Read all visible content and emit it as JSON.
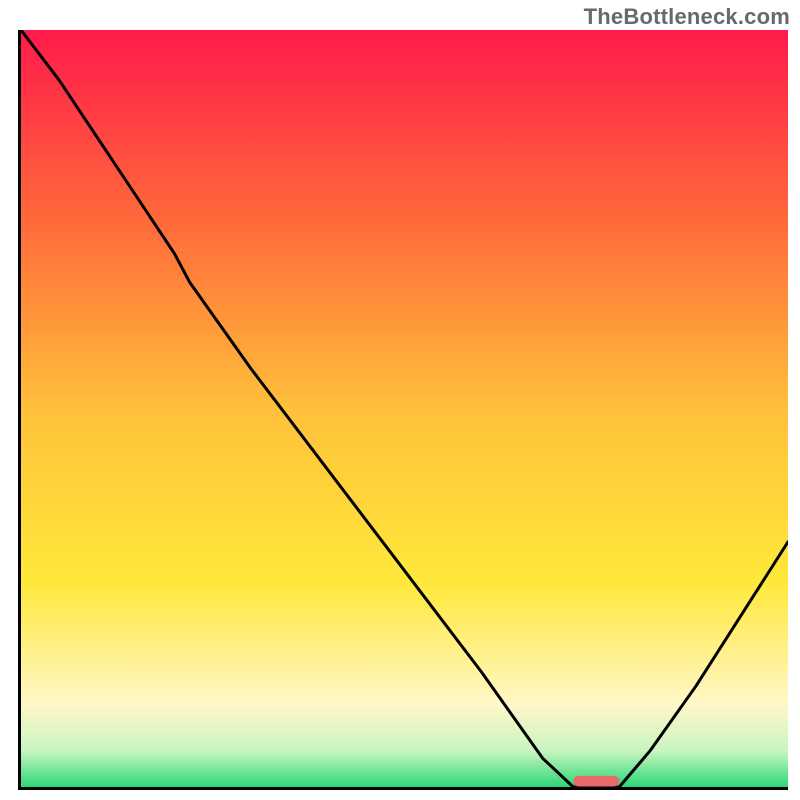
{
  "watermark": "TheBottleneck.com",
  "colors": {
    "grad_top": "#ff1a4b",
    "grad_upper": "#ff6a3a",
    "grad_mid": "#ffc23a",
    "grad_lower": "#ffe83a",
    "grad_cream": "#fff7c8",
    "grad_pale": "#c8f5c0",
    "grad_bottom": "#00d060",
    "curve": "#000000",
    "marker": "#e86a6a"
  },
  "chart_data": {
    "type": "line",
    "title": "",
    "xlabel": "",
    "ylabel": "",
    "xlim": [
      0,
      100
    ],
    "ylim": [
      0,
      105
    ],
    "x": [
      0,
      5,
      10,
      15,
      20,
      22,
      30,
      40,
      50,
      60,
      68,
      72,
      75,
      78,
      82,
      88,
      94,
      100
    ],
    "y": [
      105,
      98,
      90,
      82,
      74,
      70,
      58,
      44,
      30,
      16,
      4,
      0,
      0,
      0,
      5,
      14,
      24,
      34
    ],
    "marker": {
      "x0": 72,
      "x1": 78,
      "y": 0.6
    },
    "gradient_stops": [
      {
        "pos": 0.0,
        "color": "grad_top"
      },
      {
        "pos": 0.25,
        "color": "grad_upper"
      },
      {
        "pos": 0.5,
        "color": "grad_mid"
      },
      {
        "pos": 0.72,
        "color": "grad_lower"
      },
      {
        "pos": 0.88,
        "color": "grad_cream"
      },
      {
        "pos": 0.94,
        "color": "grad_pale"
      },
      {
        "pos": 1.0,
        "color": "grad_bottom"
      }
    ]
  }
}
